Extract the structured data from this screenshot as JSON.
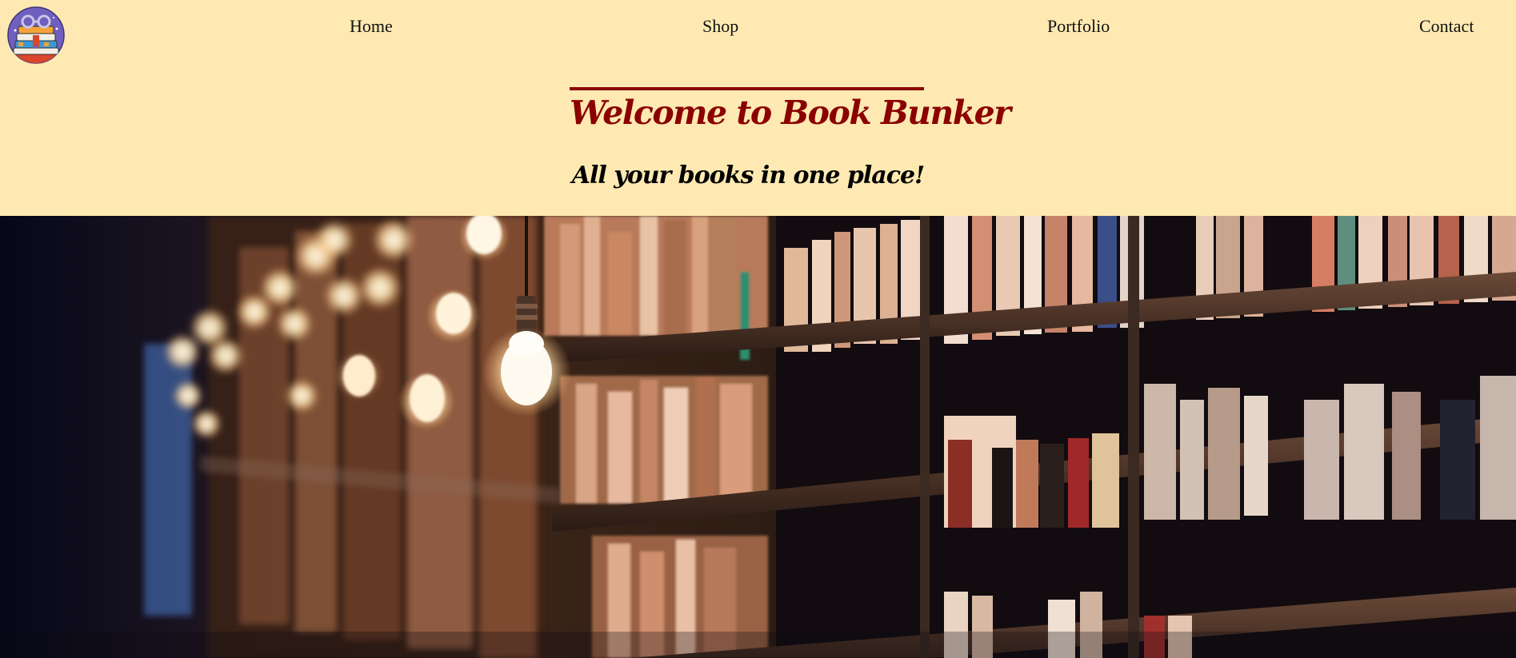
{
  "nav": {
    "logo_icon": "book-stack-logo-icon",
    "items": [
      {
        "label": "Home"
      },
      {
        "label": "Shop"
      },
      {
        "label": "Portfolio"
      },
      {
        "label": "Contact"
      }
    ]
  },
  "hero": {
    "title": "Welcome to Book Bunker",
    "subtitle": "All your books in one place!",
    "image_icon": "library-bookshelf-photo"
  },
  "colors": {
    "background": "#fde9b1",
    "title": "#8b0000",
    "text": "#111111"
  }
}
